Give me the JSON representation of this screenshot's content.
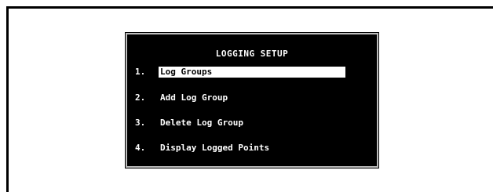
{
  "menu": {
    "title": "LOGGING SETUP",
    "items": [
      {
        "number": "1.",
        "label": "Log Groups",
        "selected": true
      },
      {
        "number": "2.",
        "label": "Add Log Group",
        "selected": false
      },
      {
        "number": "3.",
        "label": "Delete Log Group",
        "selected": false
      },
      {
        "number": "4.",
        "label": "Display Logged Points",
        "selected": false
      }
    ]
  },
  "colors": {
    "screen_background": "#000000",
    "text": "#ffffff",
    "selection_background": "#ffffff",
    "selection_text": "#000000",
    "page_background": "#ffffff"
  }
}
